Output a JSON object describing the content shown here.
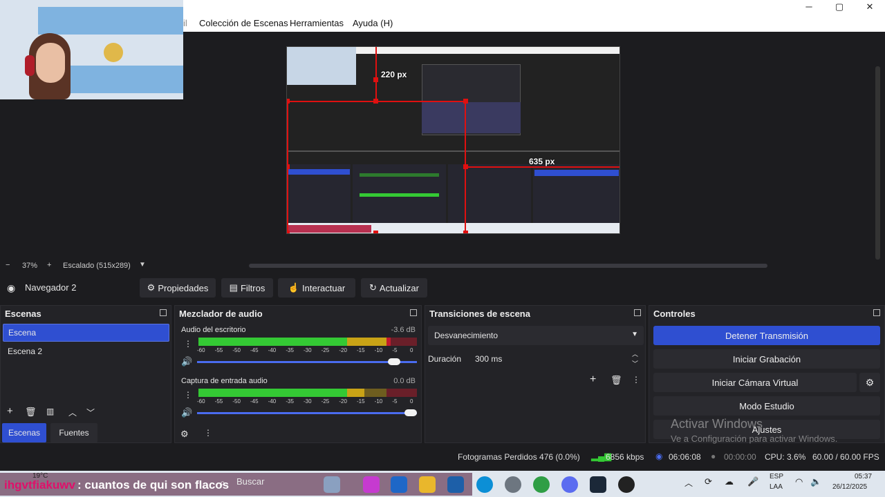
{
  "menubar": {
    "partial_item": "il",
    "scene_collection": "Colección de Escenas",
    "tools": "Herramientas",
    "help": "Ayuda (H)"
  },
  "preview": {
    "width_label": "220 px",
    "height_label": "635 px",
    "watermark_title": "Activar Windows",
    "watermark_sub": "Ve a Configuración para activar Windows."
  },
  "zoom": {
    "minus": "−",
    "percent": "37%",
    "plus": "+",
    "scale": "Escalado (515x289)"
  },
  "source_toolbar": {
    "source_name": "Navegador 2",
    "properties": "Propiedades",
    "filters": "Filtros",
    "interact": "Interactuar",
    "refresh": "Actualizar"
  },
  "scenes": {
    "title": "Escenas",
    "items": [
      "Escena",
      "Escena 2"
    ],
    "tab_scenes": "Escenas",
    "tab_sources": "Fuentes"
  },
  "mixer": {
    "title": "Mezclador de audio",
    "tracks": [
      {
        "name": "Audio del escritorio",
        "db": "-3.6 dB",
        "volume": 0.92,
        "level": 0.88
      },
      {
        "name": "Captura de entrada audio",
        "db": "0.0 dB",
        "volume": 1.0,
        "level": 0.76
      }
    ],
    "ticks": [
      "-60",
      "-55",
      "-50",
      "-45",
      "-40",
      "-35",
      "-30",
      "-25",
      "-20",
      "-15",
      "-10",
      "-5",
      "0"
    ]
  },
  "transitions": {
    "title": "Transiciones de escena",
    "selected": "Desvanecimiento",
    "duration_label": "Duración",
    "duration_value": "300 ms"
  },
  "controls": {
    "title": "Controles",
    "stop_stream": "Detener Transmisión",
    "start_record": "Iniciar Grabación",
    "start_vcam": "Iniciar Cámara Virtual",
    "studio_mode": "Modo Estudio",
    "settings": "Ajustes"
  },
  "statusbar": {
    "dropped": "Fotogramas Perdidos 476 (0.0%)",
    "bitrate": "6856 kbps",
    "stream_time": "06:06:08",
    "record_time": "00:00:00",
    "cpu": "CPU: 3.6%",
    "fps": "60.00 / 60.00 FPS"
  },
  "taskbar": {
    "weather": "19°C",
    "chat_user": "ihgvtfiakuwv",
    "chat_message": ": cuantos de qui son flacos",
    "search": "Buscar",
    "lang1": "ESP",
    "lang2": "LAA",
    "time": "05:37",
    "date": "26/12/2025"
  },
  "colors": {
    "accent": "#2f4fd1",
    "selection": "#e01010",
    "meter_green": "#34c934",
    "meter_yellow": "#c9a316",
    "meter_red": "#c21b2d"
  }
}
